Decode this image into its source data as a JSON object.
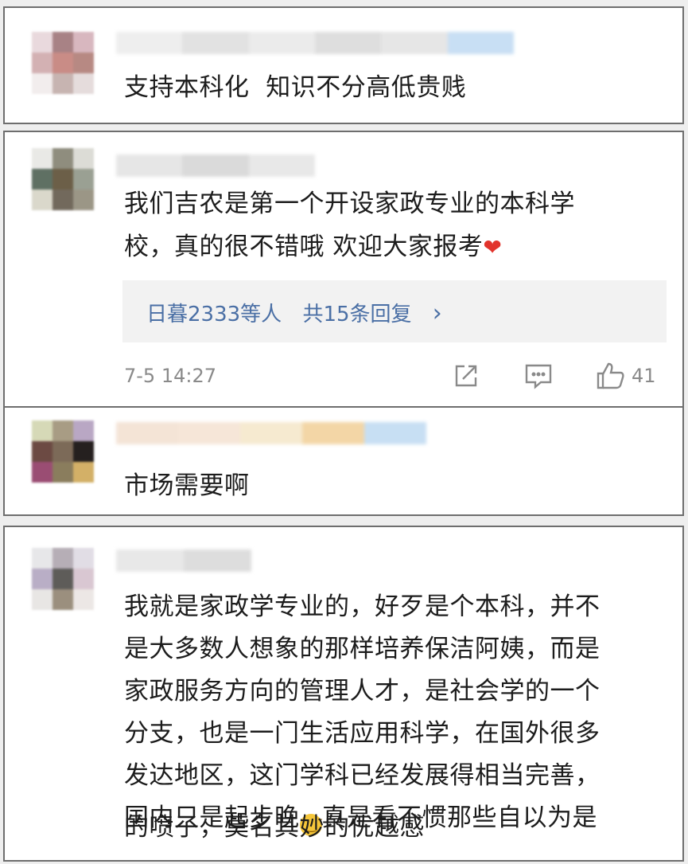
{
  "comments": [
    {
      "text": "支持本科化  知识不分高低贵贱"
    },
    {
      "text_line1": "我们吉农是第一个开设家政专业的本科学",
      "text_line2": "校，真的很不错哦 欢迎大家报考",
      "heart": "❤",
      "replies": {
        "users": "日暮2333等人",
        "count": "共15条回复",
        "chevron": "›"
      },
      "time": "7-5 14:27",
      "likes": "41"
    },
    {
      "text": "市场需要啊"
    },
    {
      "lines": [
        "我就是家政学专业的，好歹是个本科，并不",
        "是大多数人想象的那样培养保洁阿姨，而是",
        "家政服务方向的管理人才，是社会学的一个",
        "分支，也是一门生活应用科学，在国外很多",
        "发达地区，这门学科已经发展得相当完善，"
      ],
      "line6_before": "国内只是起步晚",
      "line6_after": "真是看不惯那些自以为是",
      "line7": "的喷子，莫名其妙的优越感",
      "emoji": "˘‿˘"
    }
  ],
  "icons": [
    "share-icon",
    "comment-icon",
    "like-icon",
    "heart-icon",
    "chevron-right-icon",
    "smirk-emoji-icon"
  ]
}
